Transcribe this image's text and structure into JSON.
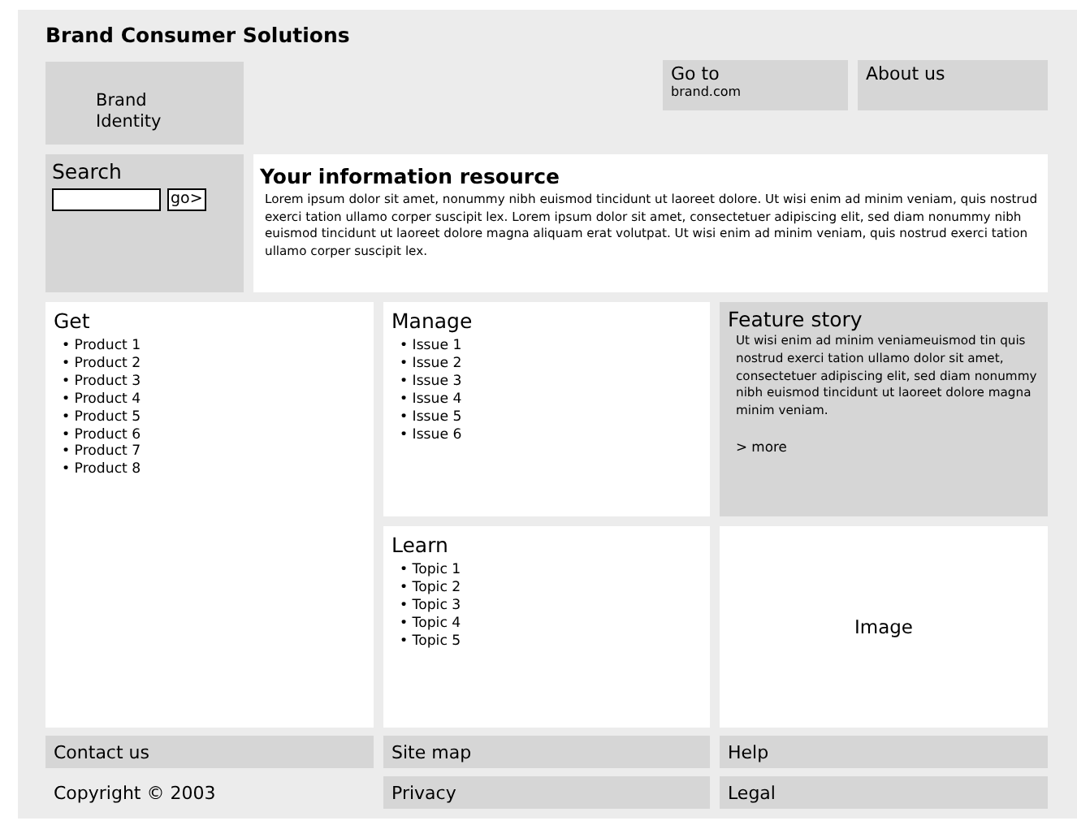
{
  "site_title": "Brand Consumer Solutions",
  "logo": {
    "lines": [
      "Brand",
      "Identity"
    ]
  },
  "nav": [
    {
      "title": "Go to",
      "subtitle": "brand.com"
    },
    {
      "title": "About us"
    }
  ],
  "search": {
    "label": "Search",
    "button": "go>"
  },
  "intro": {
    "heading": "Your information resource",
    "text": "Lorem ipsum dolor sit amet, nonummy nibh euismod tincidunt ut laoreet dolore. Ut wisi enim ad minim veniam, quis nostrud exerci tation ullamo corper suscipit lex. Lorem ipsum dolor sit amet, consectetuer adipiscing elit, sed diam nonummy nibh euismod tincidunt ut laoreet dolore magna aliquam erat volutpat. Ut wisi enim ad minim veniam, quis nostrud exerci tation ullamo corper suscipit lex."
  },
  "sections": [
    {
      "heading": "Get",
      "items": [
        "• Product 1",
        "• Product 2",
        "• Product 3",
        "• Product 4",
        "• Product 5",
        "• Product 6",
        "• Product 7",
        "• Product 8"
      ]
    },
    {
      "heading": "Manage",
      "items": [
        "• Issue 1",
        "• Issue 2",
        "• Issue 3",
        "• Issue 4",
        "• Issue 5",
        "• Issue 6"
      ]
    },
    {
      "heading": "Learn",
      "items": [
        "• Topic 1",
        "• Topic 2",
        "• Topic 3",
        "• Topic 4",
        "• Topic 5"
      ]
    }
  ],
  "feature": {
    "heading": "Feature story",
    "text": "Ut wisi enim ad minim veniameuismod tin quis nostrud exerci tation ullamo dolor sit amet, consectetuer adipiscing elit, sed diam nonummy nibh euismod tincidunt ut laoreet dolore magna minim veniam.",
    "more": "> more"
  },
  "image_placeholder": "Image",
  "footer": {
    "links": [
      "Contact us",
      "Site map",
      "Help",
      "Privacy",
      "Legal"
    ],
    "copyright": "Copyright © 2003"
  }
}
